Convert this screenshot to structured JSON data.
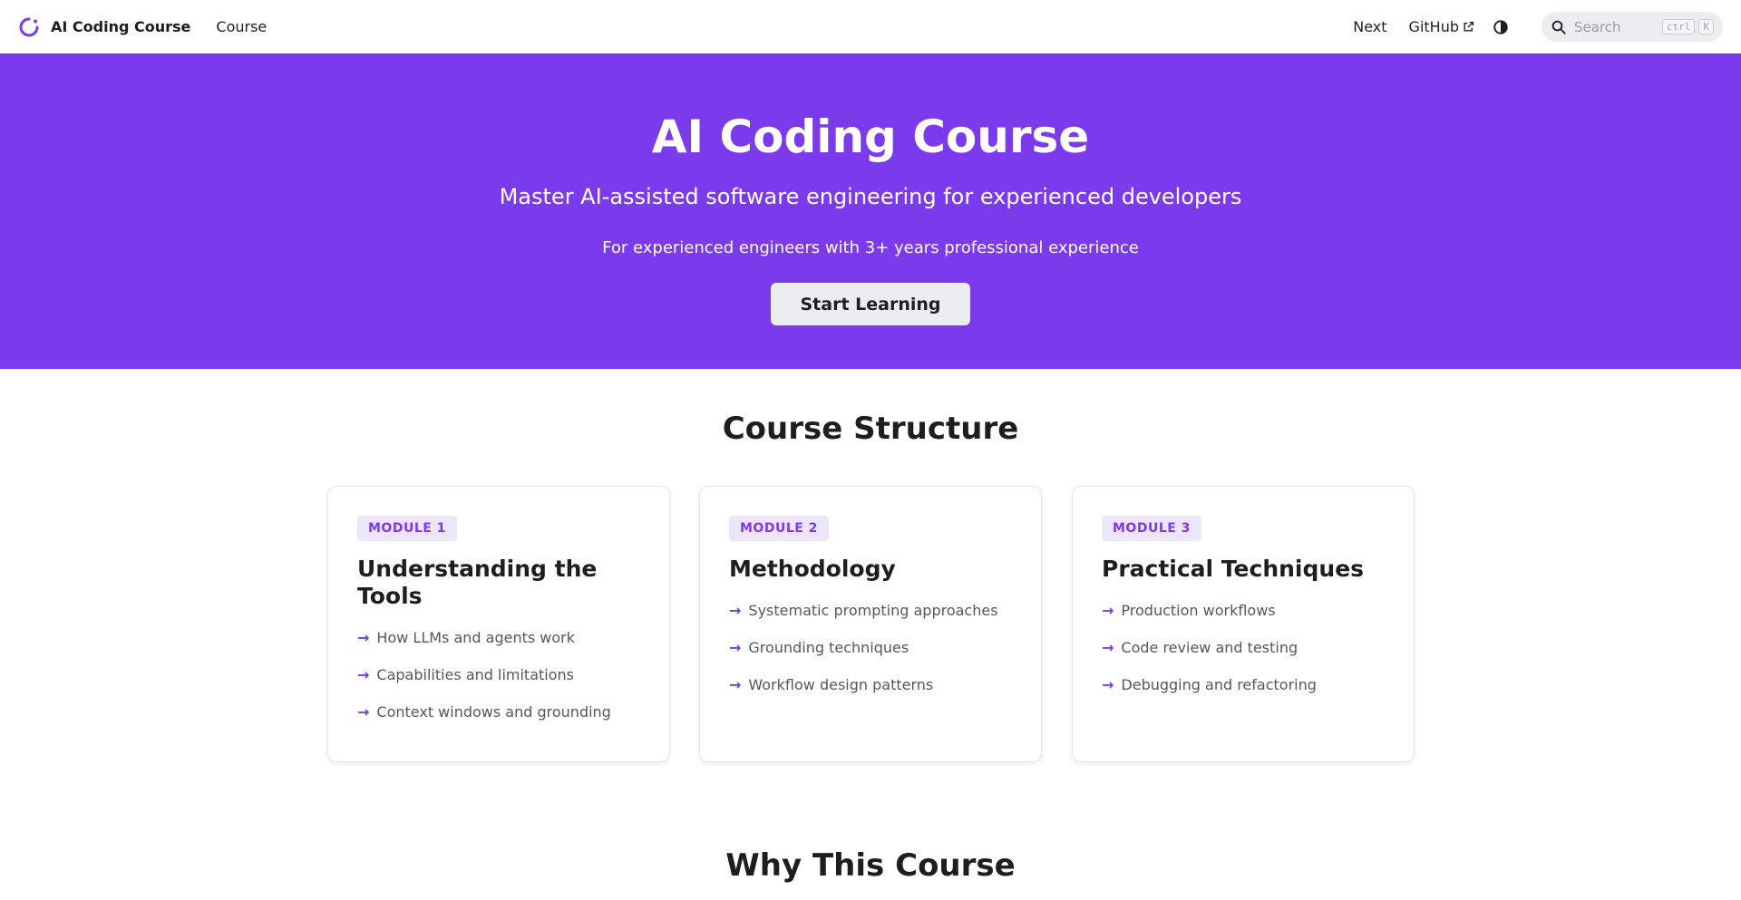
{
  "nav": {
    "brand": "AI Coding Course",
    "course_link": "Course",
    "next_link": "Next",
    "github_link": "GitHub",
    "search_placeholder": "Search",
    "search_kbd_1": "ctrl",
    "search_kbd_2": "K"
  },
  "hero": {
    "title": "AI Coding Course",
    "subtitle": "Master AI-assisted software engineering for experienced developers",
    "note": "For experienced engineers with 3+ years professional experience",
    "cta": "Start Learning"
  },
  "structure": {
    "title": "Course Structure",
    "modules": [
      {
        "badge": "MODULE 1",
        "title": "Understanding the Tools",
        "topics": [
          "How LLMs and agents work",
          "Capabilities and limitations",
          "Context windows and grounding"
        ]
      },
      {
        "badge": "MODULE 2",
        "title": "Methodology",
        "topics": [
          "Systematic prompting approaches",
          "Grounding techniques",
          "Workflow design patterns"
        ]
      },
      {
        "badge": "MODULE 3",
        "title": "Practical Techniques",
        "topics": [
          "Production workflows",
          "Code review and testing",
          "Debugging and refactoring"
        ]
      }
    ]
  },
  "why": {
    "title": "Why This Course"
  },
  "colors": {
    "accent": "#7c3aed",
    "badge_bg": "#ede6fb",
    "button_bg": "#ebedf0"
  },
  "icons": [
    "logo-icon",
    "external-link-icon",
    "theme-toggle-icon",
    "search-icon",
    "arrow-right-icon"
  ]
}
